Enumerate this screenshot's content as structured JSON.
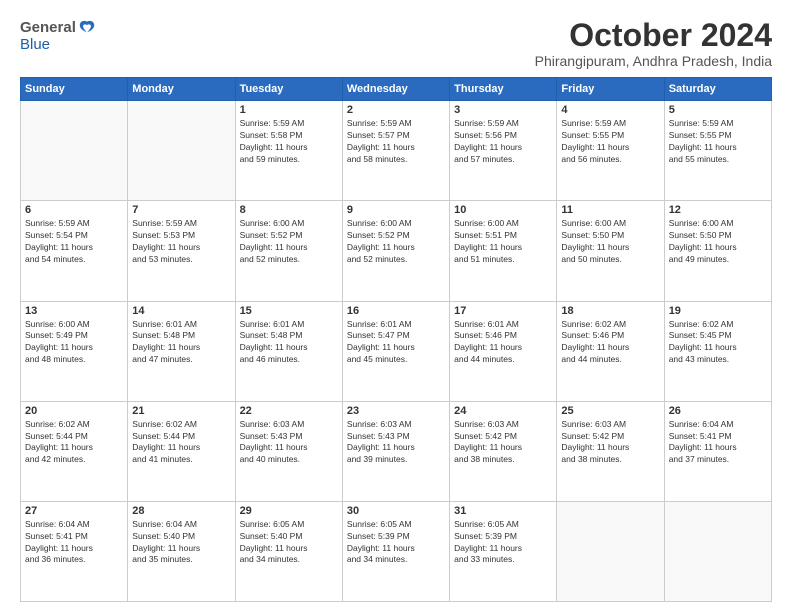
{
  "header": {
    "logo_general": "General",
    "logo_blue": "Blue",
    "month_title": "October 2024",
    "location": "Phirangipuram, Andhra Pradesh, India"
  },
  "days_of_week": [
    "Sunday",
    "Monday",
    "Tuesday",
    "Wednesday",
    "Thursday",
    "Friday",
    "Saturday"
  ],
  "weeks": [
    [
      {
        "day": "",
        "info": ""
      },
      {
        "day": "",
        "info": ""
      },
      {
        "day": "1",
        "info": "Sunrise: 5:59 AM\nSunset: 5:58 PM\nDaylight: 11 hours\nand 59 minutes."
      },
      {
        "day": "2",
        "info": "Sunrise: 5:59 AM\nSunset: 5:57 PM\nDaylight: 11 hours\nand 58 minutes."
      },
      {
        "day": "3",
        "info": "Sunrise: 5:59 AM\nSunset: 5:56 PM\nDaylight: 11 hours\nand 57 minutes."
      },
      {
        "day": "4",
        "info": "Sunrise: 5:59 AM\nSunset: 5:55 PM\nDaylight: 11 hours\nand 56 minutes."
      },
      {
        "day": "5",
        "info": "Sunrise: 5:59 AM\nSunset: 5:55 PM\nDaylight: 11 hours\nand 55 minutes."
      }
    ],
    [
      {
        "day": "6",
        "info": "Sunrise: 5:59 AM\nSunset: 5:54 PM\nDaylight: 11 hours\nand 54 minutes."
      },
      {
        "day": "7",
        "info": "Sunrise: 5:59 AM\nSunset: 5:53 PM\nDaylight: 11 hours\nand 53 minutes."
      },
      {
        "day": "8",
        "info": "Sunrise: 6:00 AM\nSunset: 5:52 PM\nDaylight: 11 hours\nand 52 minutes."
      },
      {
        "day": "9",
        "info": "Sunrise: 6:00 AM\nSunset: 5:52 PM\nDaylight: 11 hours\nand 52 minutes."
      },
      {
        "day": "10",
        "info": "Sunrise: 6:00 AM\nSunset: 5:51 PM\nDaylight: 11 hours\nand 51 minutes."
      },
      {
        "day": "11",
        "info": "Sunrise: 6:00 AM\nSunset: 5:50 PM\nDaylight: 11 hours\nand 50 minutes."
      },
      {
        "day": "12",
        "info": "Sunrise: 6:00 AM\nSunset: 5:50 PM\nDaylight: 11 hours\nand 49 minutes."
      }
    ],
    [
      {
        "day": "13",
        "info": "Sunrise: 6:00 AM\nSunset: 5:49 PM\nDaylight: 11 hours\nand 48 minutes."
      },
      {
        "day": "14",
        "info": "Sunrise: 6:01 AM\nSunset: 5:48 PM\nDaylight: 11 hours\nand 47 minutes."
      },
      {
        "day": "15",
        "info": "Sunrise: 6:01 AM\nSunset: 5:48 PM\nDaylight: 11 hours\nand 46 minutes."
      },
      {
        "day": "16",
        "info": "Sunrise: 6:01 AM\nSunset: 5:47 PM\nDaylight: 11 hours\nand 45 minutes."
      },
      {
        "day": "17",
        "info": "Sunrise: 6:01 AM\nSunset: 5:46 PM\nDaylight: 11 hours\nand 44 minutes."
      },
      {
        "day": "18",
        "info": "Sunrise: 6:02 AM\nSunset: 5:46 PM\nDaylight: 11 hours\nand 44 minutes."
      },
      {
        "day": "19",
        "info": "Sunrise: 6:02 AM\nSunset: 5:45 PM\nDaylight: 11 hours\nand 43 minutes."
      }
    ],
    [
      {
        "day": "20",
        "info": "Sunrise: 6:02 AM\nSunset: 5:44 PM\nDaylight: 11 hours\nand 42 minutes."
      },
      {
        "day": "21",
        "info": "Sunrise: 6:02 AM\nSunset: 5:44 PM\nDaylight: 11 hours\nand 41 minutes."
      },
      {
        "day": "22",
        "info": "Sunrise: 6:03 AM\nSunset: 5:43 PM\nDaylight: 11 hours\nand 40 minutes."
      },
      {
        "day": "23",
        "info": "Sunrise: 6:03 AM\nSunset: 5:43 PM\nDaylight: 11 hours\nand 39 minutes."
      },
      {
        "day": "24",
        "info": "Sunrise: 6:03 AM\nSunset: 5:42 PM\nDaylight: 11 hours\nand 38 minutes."
      },
      {
        "day": "25",
        "info": "Sunrise: 6:03 AM\nSunset: 5:42 PM\nDaylight: 11 hours\nand 38 minutes."
      },
      {
        "day": "26",
        "info": "Sunrise: 6:04 AM\nSunset: 5:41 PM\nDaylight: 11 hours\nand 37 minutes."
      }
    ],
    [
      {
        "day": "27",
        "info": "Sunrise: 6:04 AM\nSunset: 5:41 PM\nDaylight: 11 hours\nand 36 minutes."
      },
      {
        "day": "28",
        "info": "Sunrise: 6:04 AM\nSunset: 5:40 PM\nDaylight: 11 hours\nand 35 minutes."
      },
      {
        "day": "29",
        "info": "Sunrise: 6:05 AM\nSunset: 5:40 PM\nDaylight: 11 hours\nand 34 minutes."
      },
      {
        "day": "30",
        "info": "Sunrise: 6:05 AM\nSunset: 5:39 PM\nDaylight: 11 hours\nand 34 minutes."
      },
      {
        "day": "31",
        "info": "Sunrise: 6:05 AM\nSunset: 5:39 PM\nDaylight: 11 hours\nand 33 minutes."
      },
      {
        "day": "",
        "info": ""
      },
      {
        "day": "",
        "info": ""
      }
    ]
  ]
}
